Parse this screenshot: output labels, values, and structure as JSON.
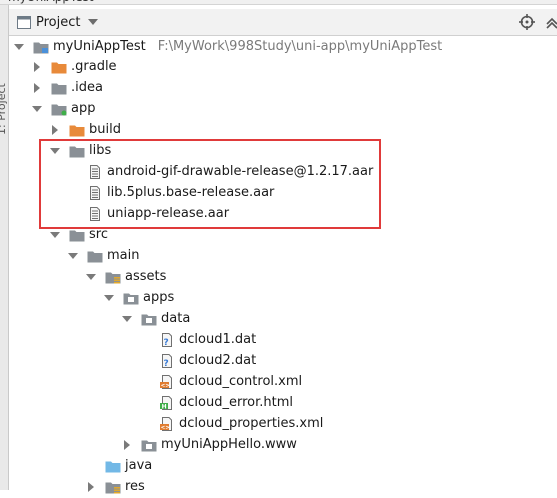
{
  "topbar": {
    "title": "myUniAppTest"
  },
  "sidebar": {
    "label": "1: Project"
  },
  "header": {
    "view_label": "Project"
  },
  "tree": {
    "root": {
      "label": "myUniAppTest",
      "path": "F:\\MyWork\\998Study\\uni-app\\myUniAppTest"
    },
    "gradle": {
      "label": ".gradle"
    },
    "idea": {
      "label": ".idea"
    },
    "app": {
      "label": "app"
    },
    "build": {
      "label": "build"
    },
    "libs": {
      "label": "libs"
    },
    "lib_gif": {
      "label": "android-gif-drawable-release@1.2.17.aar"
    },
    "lib_5plus": {
      "label": "lib.5plus.base-release.aar"
    },
    "lib_uniapp": {
      "label": "uniapp-release.aar"
    },
    "src": {
      "label": "src"
    },
    "main": {
      "label": "main"
    },
    "assets": {
      "label": "assets"
    },
    "apps": {
      "label": "apps"
    },
    "data": {
      "label": "data"
    },
    "dcloud1": {
      "label": "dcloud1.dat"
    },
    "dcloud2": {
      "label": "dcloud2.dat"
    },
    "dcloud_control": {
      "label": "dcloud_control.xml"
    },
    "dcloud_error": {
      "label": "dcloud_error.html"
    },
    "dcloud_properties": {
      "label": "dcloud_properties.xml"
    },
    "myUniAppHello": {
      "label": "myUniAppHello.www"
    },
    "java": {
      "label": "java"
    },
    "res": {
      "label": "res"
    }
  },
  "colors": {
    "highlight": "#e03a3a",
    "folder": "#8a9096",
    "excluded_folder": "#e88a3a",
    "source_folder": "#72b8e6",
    "header_bg": "#f2f2f2"
  }
}
